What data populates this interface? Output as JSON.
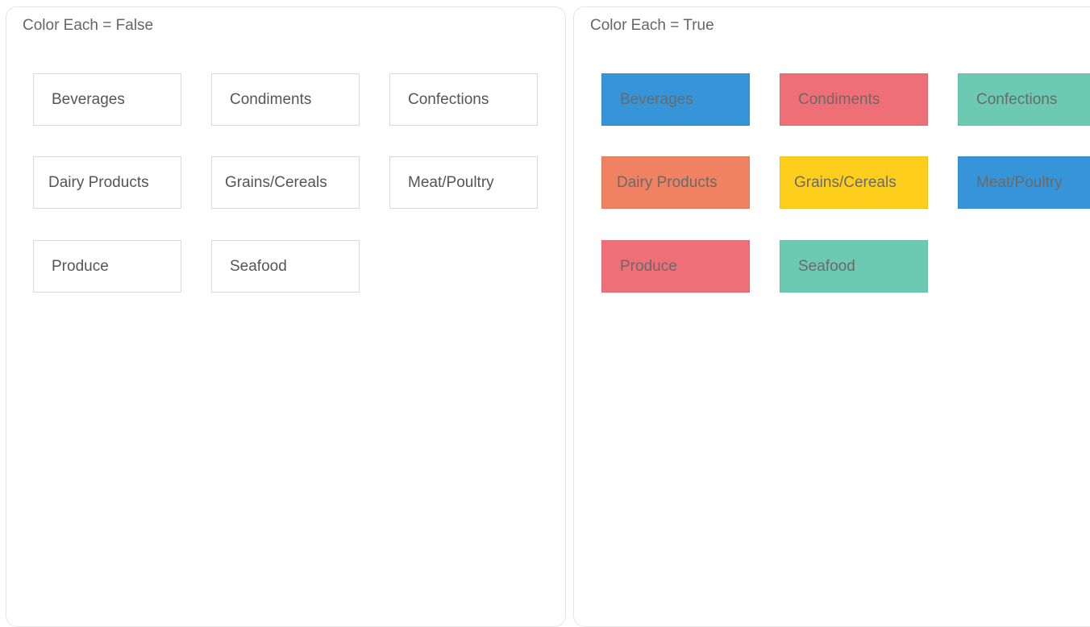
{
  "panels": [
    {
      "title": "Color Each = False",
      "items": [
        "Beverages",
        "Condiments",
        "Confections",
        "Dairy Products",
        "Grains/Cereals",
        "Meat/Poultry",
        "Produce",
        "Seafood"
      ]
    },
    {
      "title": "Color Each = True",
      "items": [
        "Beverages",
        "Condiments",
        "Confections",
        "Dairy Products",
        "Grains/Cereals",
        "Meat/Poultry",
        "Produce",
        "Seafood"
      ],
      "colors": [
        "#3595d8",
        "#ef6f77",
        "#6dcab2",
        "#f08262",
        "#fdce1b",
        "#3595d8",
        "#ef6f77",
        "#6dcab2"
      ]
    }
  ]
}
